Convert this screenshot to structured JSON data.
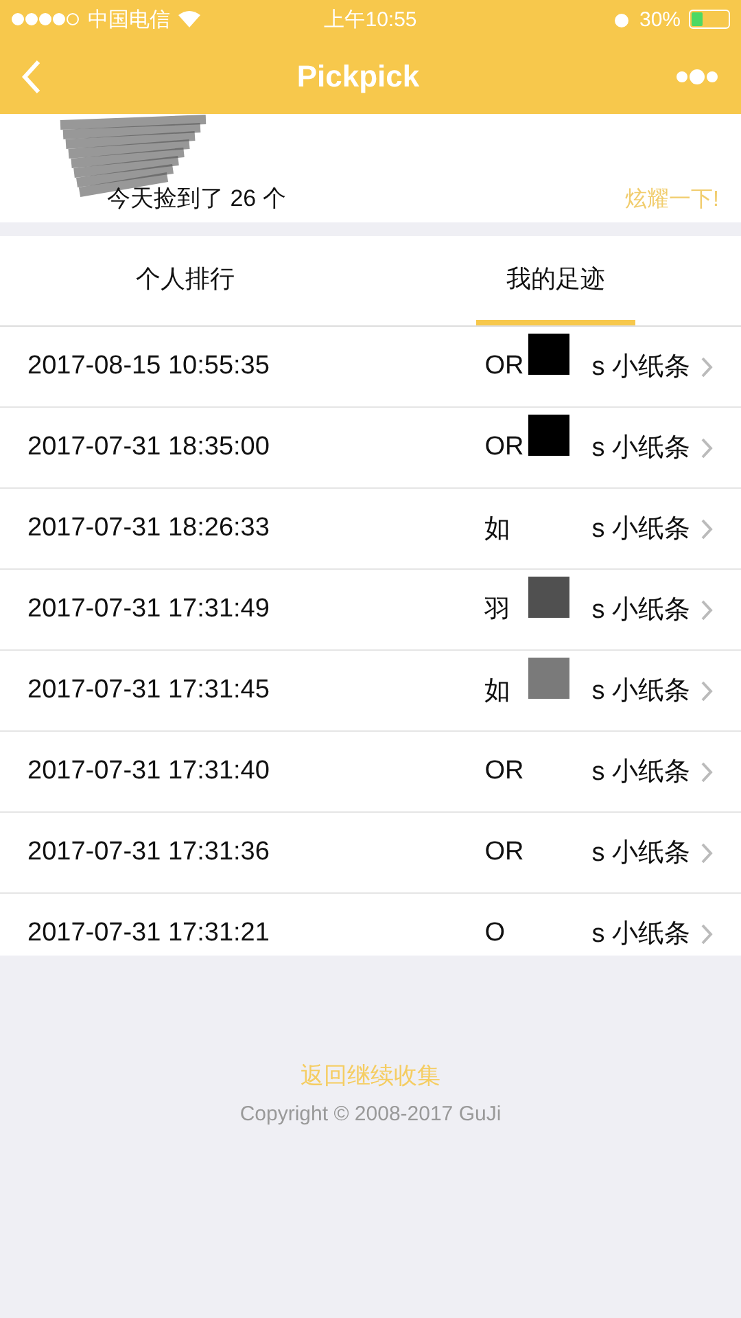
{
  "status_bar": {
    "carrier": "中国电信",
    "time": "上午10:55",
    "battery": "30%"
  },
  "nav": {
    "title": "Pickpick"
  },
  "profile": {
    "summary": "今天捡到了 26 个",
    "share_link": "炫耀一下!"
  },
  "tabs": [
    {
      "label": "个人排行",
      "selected": false
    },
    {
      "label": "我的足迹",
      "selected": true
    }
  ],
  "records": [
    {
      "time": "2017-08-15 10:55:35",
      "owner": "OR",
      "note": "s 小纸条",
      "color": "#000000"
    },
    {
      "time": "2017-07-31 18:35:00",
      "owner": "OR",
      "note": "s 小纸条",
      "color": "#000000"
    },
    {
      "time": "2017-07-31 18:26:33",
      "owner": "如",
      "note": "s 小纸条"
    },
    {
      "time": "2017-07-31 17:31:49",
      "owner": "羽",
      "note": "s 小纸条",
      "color": "#505050"
    },
    {
      "time": "2017-07-31 17:31:45",
      "owner": "如",
      "note": "s 小纸条",
      "color": "#7a7a7a"
    },
    {
      "time": "2017-07-31 17:31:40",
      "owner": "OR",
      "note": "s 小纸条"
    },
    {
      "time": "2017-07-31 17:31:36",
      "owner": "OR",
      "note": "s 小纸条"
    },
    {
      "time": "2017-07-31 17:31:21",
      "owner": "O",
      "note": "s 小纸条"
    }
  ],
  "footer": {
    "back_link": "返回继续收集",
    "copyright": "Copyright © 2008-2017 GuJi"
  }
}
